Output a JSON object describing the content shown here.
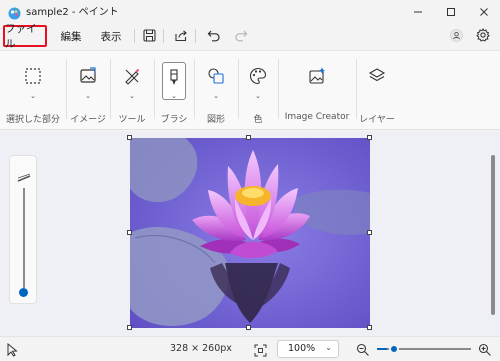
{
  "window": {
    "title": "sample2 - ペイント"
  },
  "menu": {
    "file": "ファイル",
    "edit": "編集",
    "view": "表示"
  },
  "ribbon": {
    "groups": [
      {
        "label": "選択した部分",
        "icon": "selection-icon"
      },
      {
        "label": "イメージ",
        "icon": "image-icon"
      },
      {
        "label": "ツール",
        "icon": "tools-icon"
      },
      {
        "label": "ブラシ",
        "icon": "brush-icon"
      },
      {
        "label": "図形",
        "icon": "shapes-icon"
      },
      {
        "label": "色",
        "icon": "palette-icon"
      },
      {
        "label": "Image Creator",
        "icon": "image-creator-icon"
      },
      {
        "label": "レイヤー",
        "icon": "layers-icon"
      }
    ]
  },
  "status": {
    "dimensions": "328 × 260px",
    "zoom": "100%"
  },
  "colors": {
    "accent": "#0067c0",
    "highlight": "#e81123"
  }
}
